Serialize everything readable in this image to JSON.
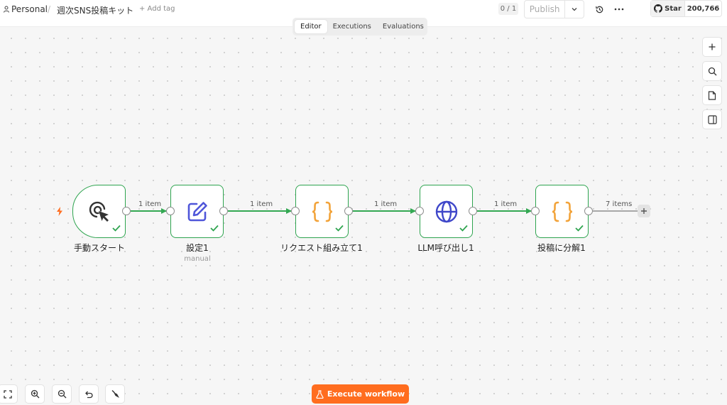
{
  "breadcrumb": {
    "project": "Personal",
    "separator": "/",
    "workflow_name": "週次SNS投稿キット",
    "add_tag": "+ Add tag"
  },
  "header": {
    "counter": "0 / 1",
    "publish_label": "Publish",
    "github_star_label": "Star",
    "github_star_count": "200,766"
  },
  "tabs": [
    {
      "label": "Editor",
      "active": true
    },
    {
      "label": "Executions",
      "active": false
    },
    {
      "label": "Evaluations",
      "active": false
    }
  ],
  "nodes": [
    {
      "label": "手動スタート",
      "sub": "",
      "icon": "cursor-click-icon"
    },
    {
      "label": "設定1",
      "sub": "manual",
      "icon": "edit-icon"
    },
    {
      "label": "リクエスト組み立て1",
      "sub": "",
      "icon": "code-braces-icon"
    },
    {
      "label": "LLM呼び出し1",
      "sub": "",
      "icon": "globe-icon"
    },
    {
      "label": "投稿に分解1",
      "sub": "",
      "icon": "code-braces-icon"
    }
  ],
  "edges": [
    {
      "label": "1 item"
    },
    {
      "label": "1 item"
    },
    {
      "label": "1 item"
    },
    {
      "label": "1 item"
    },
    {
      "label": "7 items"
    }
  ],
  "footer": {
    "execute_label": "Execute workflow"
  },
  "colors": {
    "accent": "#ff6d1f",
    "success": "#2ea44f",
    "edge": "#34a853",
    "code_icon": "#f2a33a",
    "edit_icon": "#4f56d9",
    "globe_icon": "#3f47c9"
  }
}
